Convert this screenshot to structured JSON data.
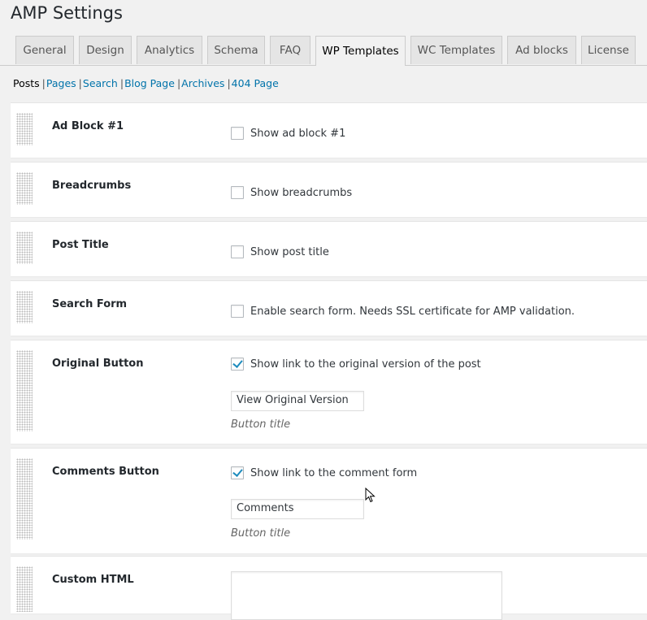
{
  "page": {
    "title": "AMP Settings"
  },
  "tabs": [
    {
      "label": "General"
    },
    {
      "label": "Design"
    },
    {
      "label": "Analytics"
    },
    {
      "label": "Schema"
    },
    {
      "label": "FAQ"
    },
    {
      "label": "WP Templates",
      "active": true
    },
    {
      "label": "WC Templates"
    },
    {
      "label": "Ad blocks"
    },
    {
      "label": "License"
    }
  ],
  "subnav": {
    "current": "Posts",
    "links": [
      "Pages",
      "Search",
      "Blog Page",
      "Archives",
      "404 Page"
    ]
  },
  "blocks": {
    "ad_block": {
      "label": "Ad Block #1",
      "option": "Show ad block #1",
      "checked": false
    },
    "breadcrumbs": {
      "label": "Breadcrumbs",
      "option": "Show breadcrumbs",
      "checked": false
    },
    "post_title": {
      "label": "Post Title",
      "option": "Show post title",
      "checked": false
    },
    "search_form": {
      "label": "Search Form",
      "option": "Enable search form. Needs SSL certificate for AMP validation.",
      "checked": false
    },
    "original_button": {
      "label": "Original Button",
      "option": "Show link to the original version of the post",
      "checked": true,
      "input_value": "View Original Version",
      "description": "Button title"
    },
    "comments_button": {
      "label": "Comments Button",
      "option": "Show link to the comment form",
      "checked": true,
      "input_value": "Comments",
      "description": "Button title"
    },
    "custom_html": {
      "label": "Custom HTML",
      "value": ""
    }
  },
  "colors": {
    "link": "#0073aa",
    "checkmark": "#1e8cbe",
    "background": "#f1f1f1"
  }
}
